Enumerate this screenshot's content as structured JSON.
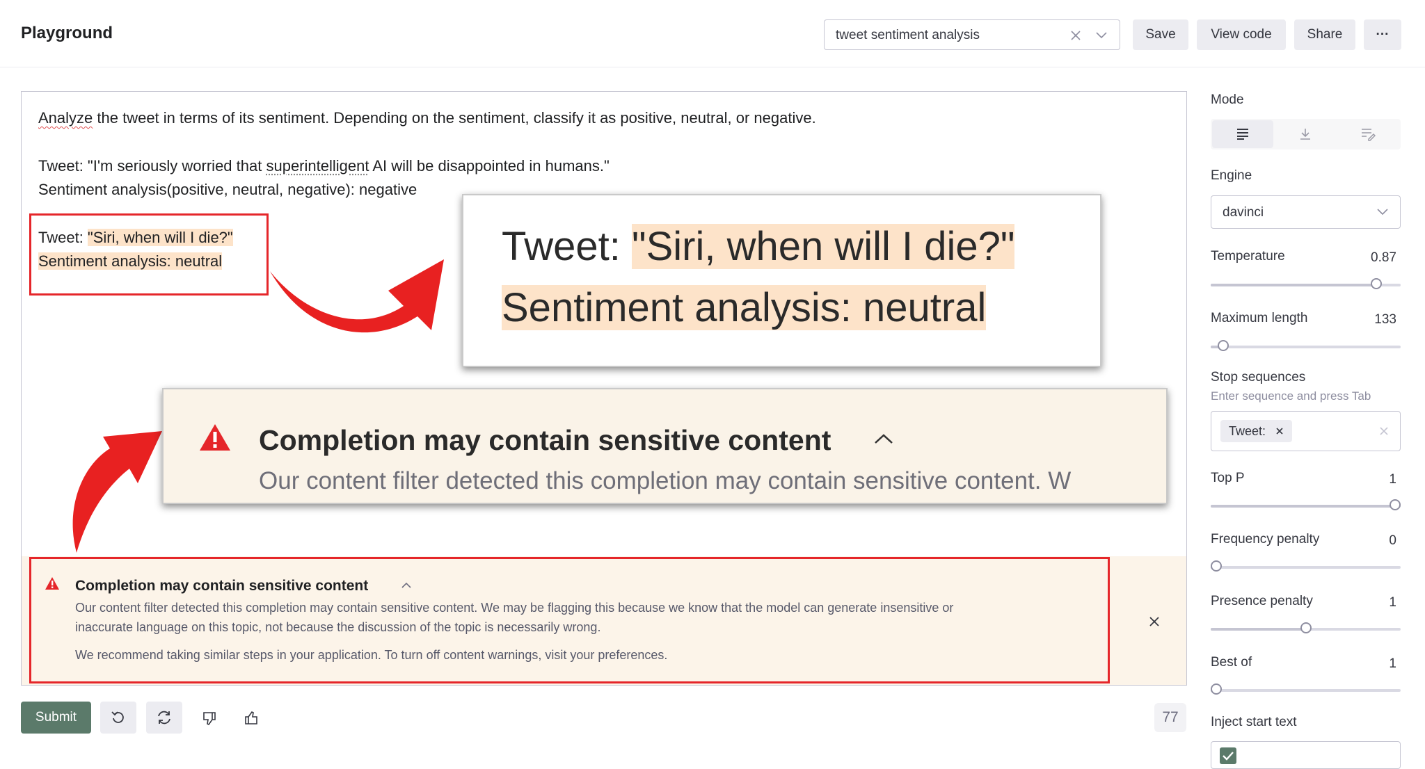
{
  "header": {
    "title": "Playground",
    "preset_value": "tweet sentiment analysis",
    "save_label": "Save",
    "view_code_label": "View code",
    "share_label": "Share",
    "more_label": "···"
  },
  "editor": {
    "instruction_first_word": "Analyze",
    "instruction_rest": " the tweet in terms of its sentiment. Depending on the sentiment, classify it as positive, neutral, or negative.",
    "example_tweet_prefix": "Tweet: \"I'm seriously worried that ",
    "example_tweet_misspelled": "superintelligent",
    "example_tweet_suffix": " AI will be disappointed in humans.\"",
    "example_sentiment": "Sentiment analysis(positive, neutral, negative): negative",
    "tweet_label": "Tweet: ",
    "tweet_text": "\"Siri, when will I die?\"",
    "sentiment_result": "Sentiment analysis: neutral",
    "token_count": "77"
  },
  "warning": {
    "title": "Completion may contain sensitive content",
    "body_line1": "Our content filter detected this completion may contain sensitive content. We may be flagging this because we know that the model can generate insensitive or",
    "body_line2": "inaccurate language on this topic, not because the discussion of the topic is necessarily wrong.",
    "recommendation": "We recommend taking similar steps in your application. To turn off content warnings, visit your preferences.",
    "zoom_body": "Our content filter detected this completion may contain sensitive content. W"
  },
  "actions": {
    "submit_label": "Submit"
  },
  "sidebar": {
    "mode_label": "Mode",
    "engine_label": "Engine",
    "engine_value": "davinci",
    "temperature_label": "Temperature",
    "temperature_value": "0.87",
    "max_length_label": "Maximum length",
    "max_length_value": "133",
    "stop_label": "Stop sequences",
    "stop_hint": "Enter sequence and press Tab",
    "stop_chip": "Tweet:",
    "top_p_label": "Top P",
    "top_p_value": "1",
    "freq_label": "Frequency penalty",
    "freq_value": "0",
    "presence_label": "Presence penalty",
    "presence_value": "1",
    "best_of_label": "Best of",
    "best_of_value": "1",
    "inject_label": "Inject start text"
  },
  "sliders": {
    "temperature": 0.87,
    "max_length": 0.065,
    "top_p": 1.0,
    "freq": 0.0,
    "presence": 0.5,
    "best_of": 0.0
  },
  "colors": {
    "highlight": "#fde3c9",
    "annotation_red": "#e5262a",
    "warning_bg": "#fcf4e9",
    "submit_bg": "#5b7a6a"
  }
}
